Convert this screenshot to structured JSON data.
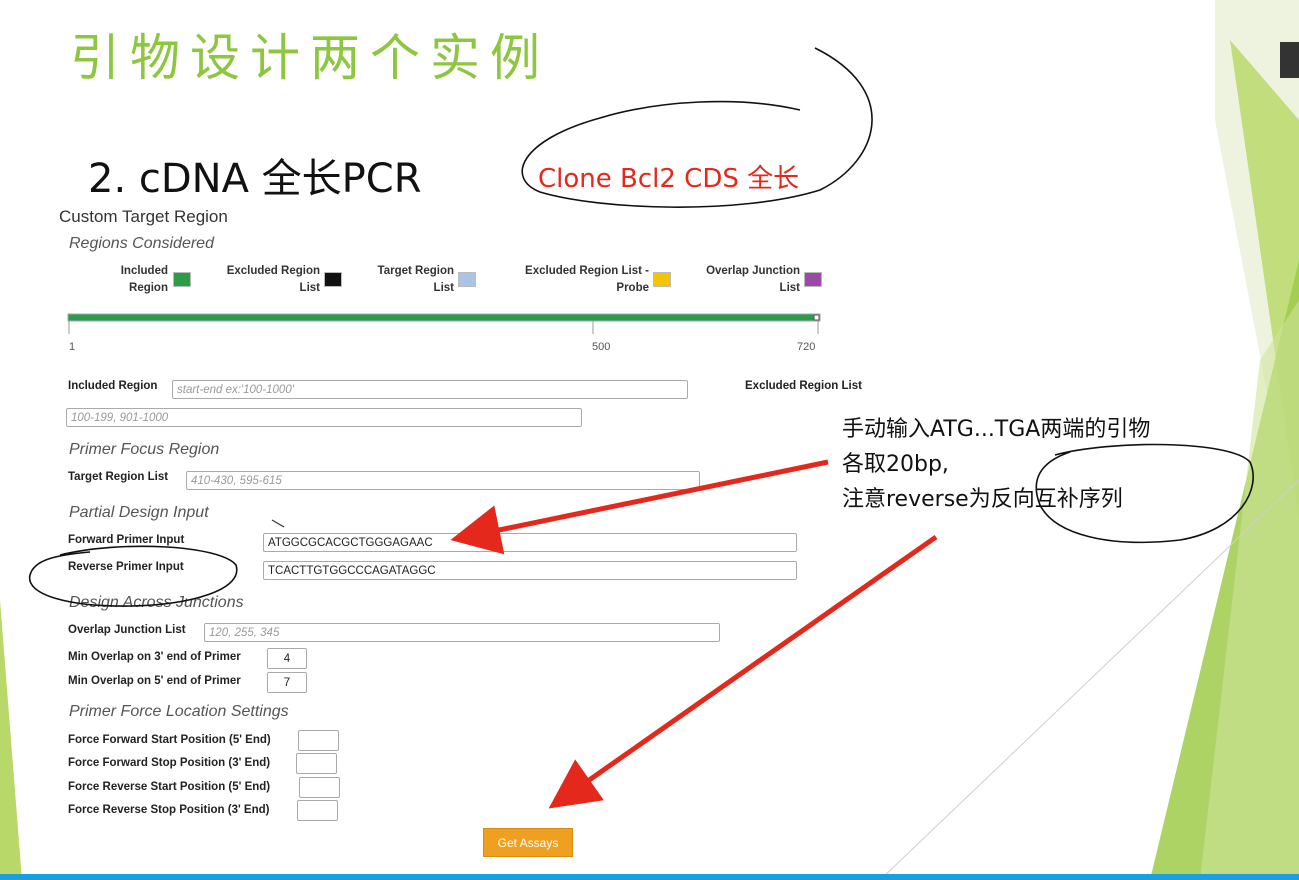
{
  "slide": {
    "title": "引物设计两个实例",
    "subtitle": "2. cDNA 全长PCR",
    "note_circled": "Clone Bcl2 CDS 全长",
    "note_lines": [
      "手动输入ATG...TGA两端的引物",
      "各取20bp,",
      "注意reverse为反向互补序列"
    ]
  },
  "form": {
    "title": "Custom Target Region",
    "regions_considered": "Regions Considered",
    "legend": [
      {
        "label": "Included Region",
        "color": "#2e9b46"
      },
      {
        "label": "Excluded Region List",
        "color": "#111111"
      },
      {
        "label": "Target Region List",
        "color": "#a9c4e4"
      },
      {
        "label": "Excluded Region List - Probe",
        "color": "#f2c500"
      },
      {
        "label": "Overlap Junction List",
        "color": "#9b4aa8"
      }
    ],
    "bar": {
      "tick_start": "1",
      "tick_mid": "500",
      "tick_end": "720",
      "color": "#2e9b46"
    },
    "included_region_label": "Included Region",
    "included_region_placeholder": "start-end ex:'100-1000'",
    "excluded_region_label": "Excluded Region List",
    "excluded_region_placeholder": "100-199, 901-1000",
    "primer_focus": "Primer Focus Region",
    "target_region_label": "Target Region List",
    "target_region_placeholder": "410-430, 595-615",
    "partial_design": "Partial Design Input",
    "forward_label": "Forward Primer Input",
    "forward_value": "ATGGCGCACGCTGGGAGAAC",
    "reverse_label": "Reverse Primer Input",
    "reverse_value": "TCACTTGTGGCCCAGATAGGC",
    "design_across": "Design Across Junctions",
    "overlap_label": "Overlap Junction List",
    "overlap_placeholder": "120, 255, 345",
    "min3_label": "Min Overlap on 3' end of Primer",
    "min3_value": "4",
    "min5_label": "Min Overlap on 5' end of Primer",
    "min5_value": "7",
    "force_section": "Primer Force Location Settings",
    "force_fwd_start": "Force Forward Start Position (5' End)",
    "force_fwd_stop": "Force Forward Stop Position (3' End)",
    "force_rev_start": "Force Reverse Start Position (5' End)",
    "force_rev_stop": "Force Reverse Stop Position (3' End)",
    "get_assays": "Get Assays"
  }
}
